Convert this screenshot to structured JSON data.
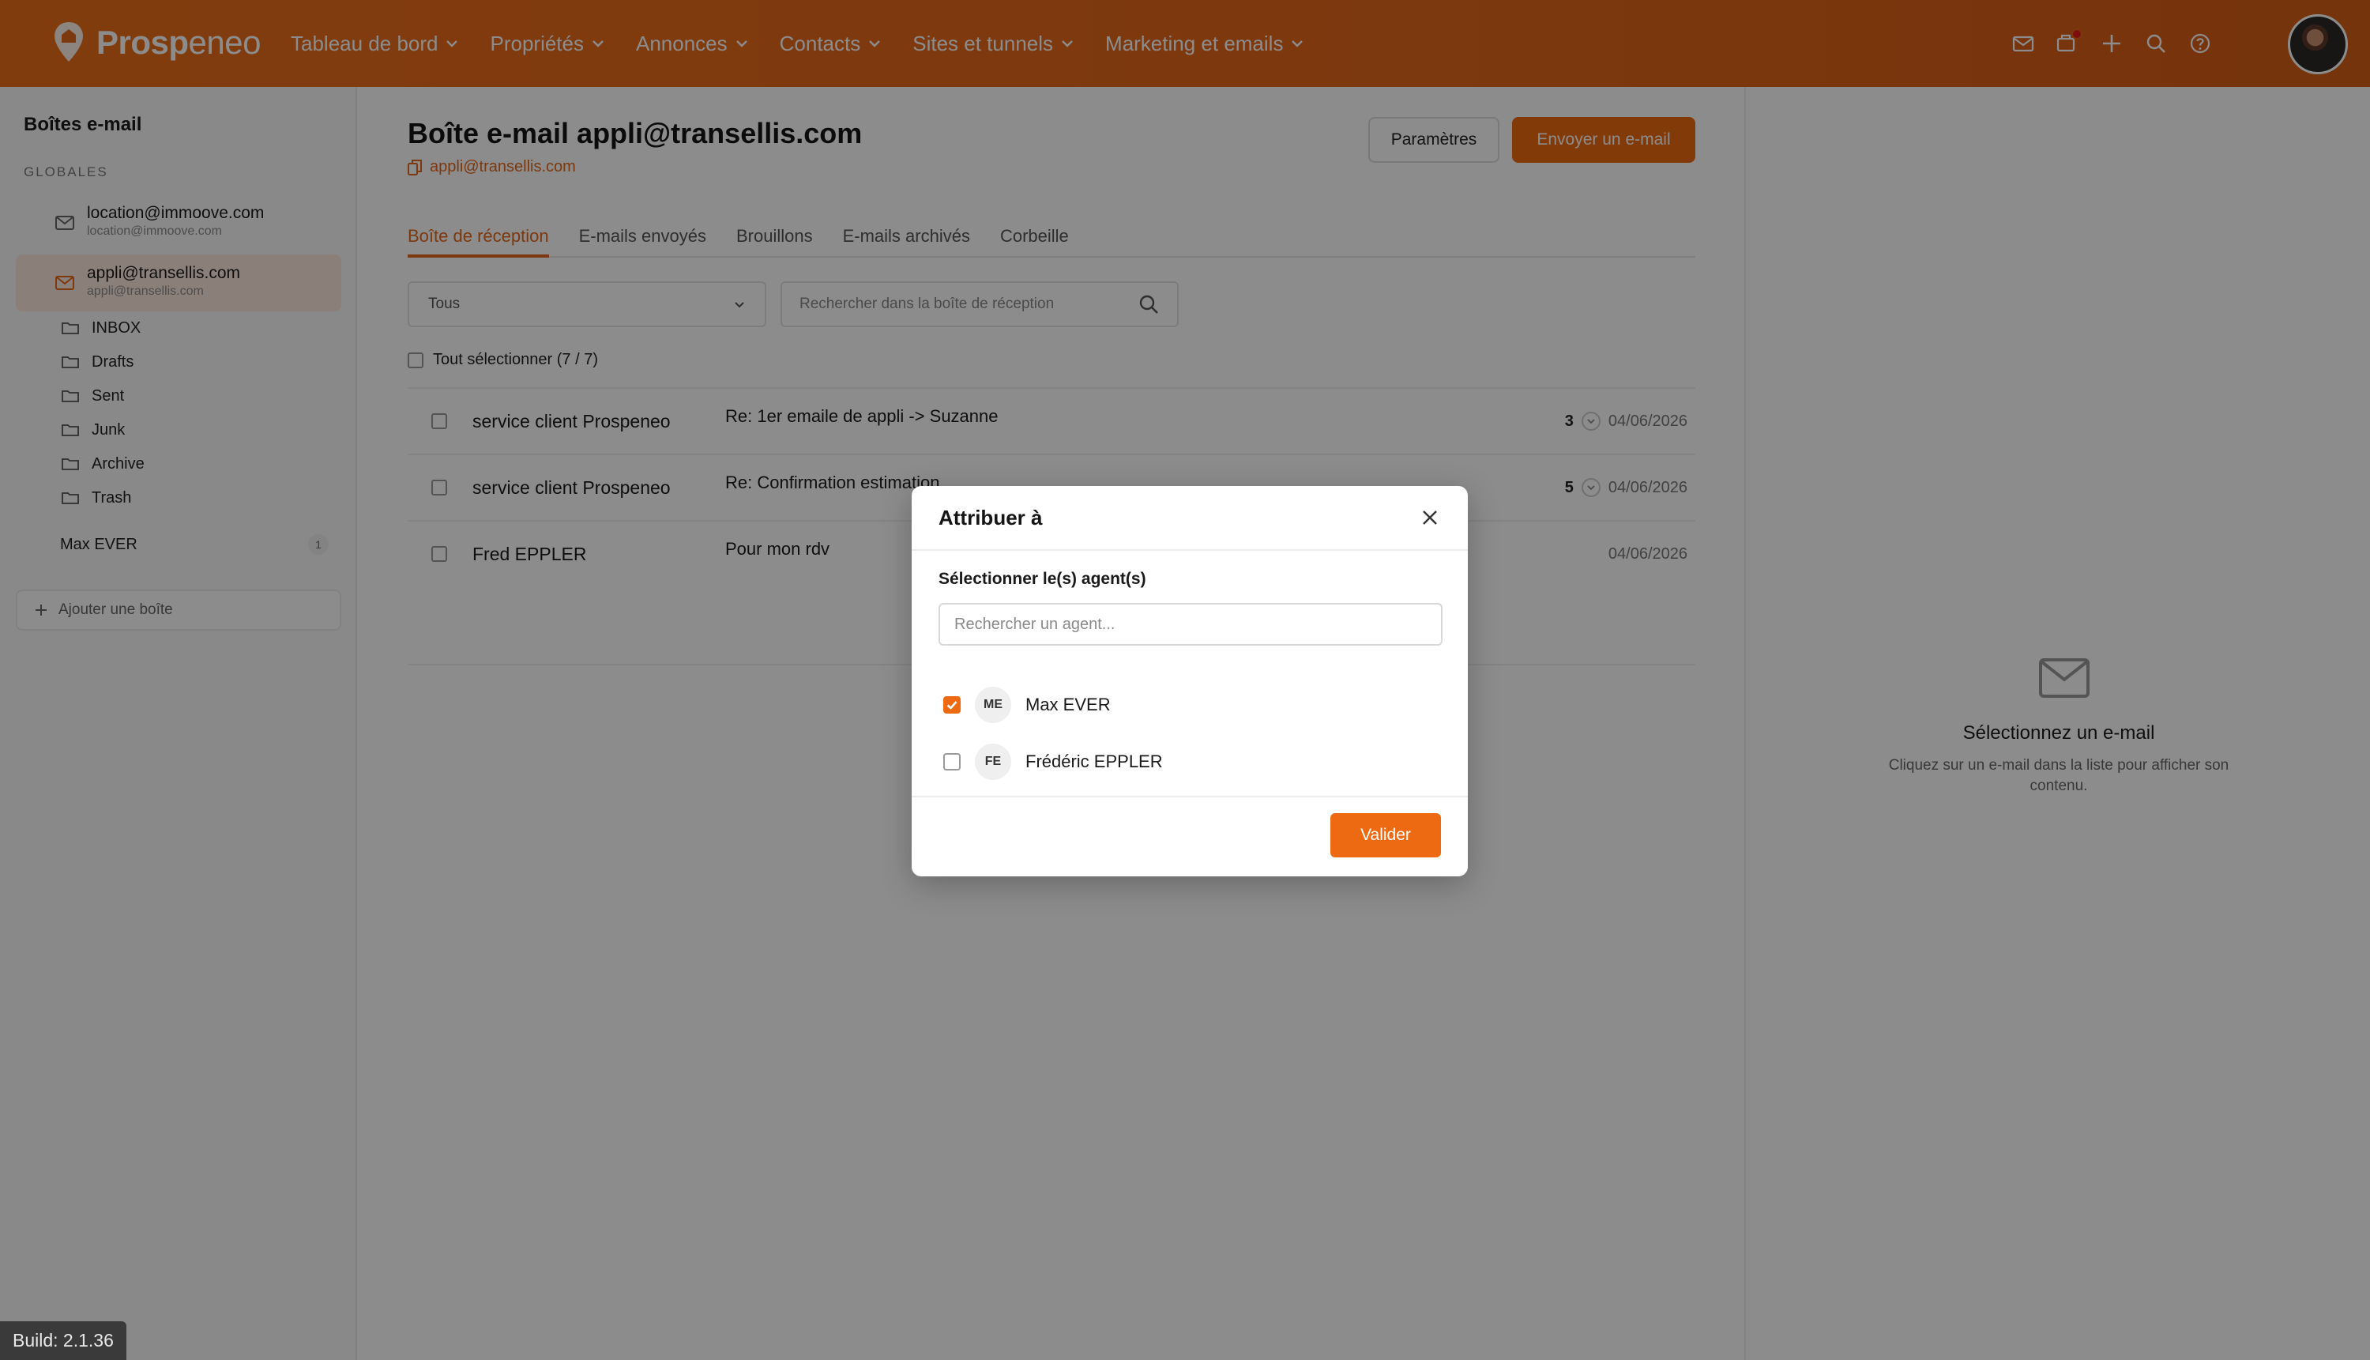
{
  "brand": {
    "name_bold": "Prosp",
    "name_light": "eneo",
    "accent": "#ed6a12"
  },
  "nav": [
    {
      "label": "Tableau de bord"
    },
    {
      "label": "Propriétés"
    },
    {
      "label": "Annonces"
    },
    {
      "label": "Contacts"
    },
    {
      "label": "Sites et tunnels"
    },
    {
      "label": "Marketing et emails"
    }
  ],
  "top_icons": [
    "mail-icon",
    "notifications-icon",
    "plus-icon",
    "search-icon",
    "help-icon"
  ],
  "sidebar": {
    "title": "Boîtes e-mail",
    "section": "GLOBALES",
    "mailboxes": [
      {
        "main": "location@immoove.com",
        "sub": "location@immoove.com"
      },
      {
        "main": "appli@transellis.com",
        "sub": "appli@transellis.com"
      }
    ],
    "folders": [
      "INBOX",
      "Drafts",
      "Sent",
      "Junk",
      "Archive",
      "Trash"
    ],
    "agent": {
      "name": "Max EVER",
      "count": "1"
    },
    "add_label": "Ajouter une boîte"
  },
  "main": {
    "title": "Boîte e-mail appli@transellis.com",
    "subtitle": "appli@transellis.com",
    "settings_label": "Paramètres",
    "send_label": "Envoyer un e-mail",
    "tabs": [
      "Boîte de réception",
      "E-mails envoyés",
      "Brouillons",
      "E-mails archivés",
      "Corbeille"
    ],
    "filter_value": "Tous",
    "search_placeholder": "Rechercher dans la boîte de réception",
    "select_all": "Tout sélectionner (7 / 7)",
    "emails": [
      {
        "sender": "service client Prospeneo",
        "subject": "Re: 1er emaile de appli -> Suzanne",
        "count": "3",
        "date": "04/06/2026"
      },
      {
        "sender": "service client Prospeneo",
        "subject": "Re: Confirmation estimation",
        "count": "5",
        "date": "04/06/2026"
      },
      {
        "sender": "Fred EPPLER",
        "subject": "Pour mon rdv",
        "count": "",
        "date": "04/06/2026"
      }
    ]
  },
  "right_panel": {
    "title": "Sélectionnez un e-mail",
    "desc": "Cliquez sur un e-mail dans la liste pour afficher son contenu."
  },
  "modal": {
    "title": "Attribuer à",
    "label": "Sélectionner le(s) agent(s)",
    "search_placeholder": "Rechercher un agent...",
    "agents": [
      {
        "initials": "ME",
        "name": "Max EVER",
        "checked": true
      },
      {
        "initials": "FE",
        "name": "Frédéric EPPLER",
        "checked": false
      }
    ],
    "confirm_label": "Valider"
  },
  "build": "Build: 2.1.36"
}
